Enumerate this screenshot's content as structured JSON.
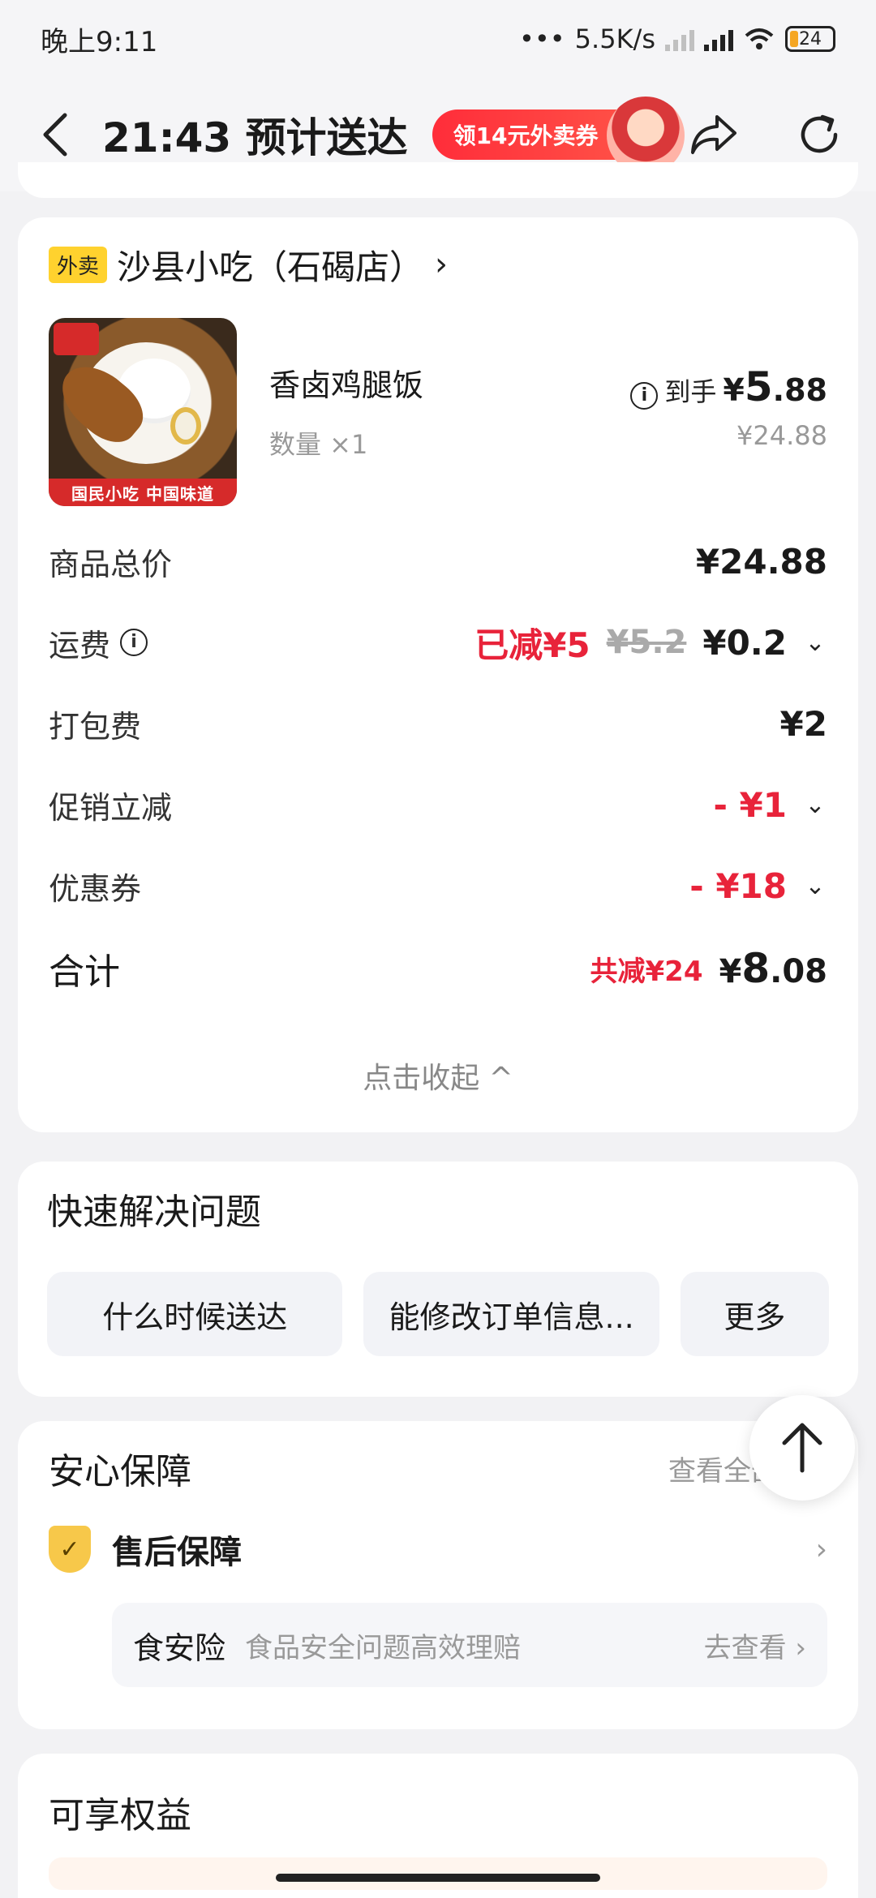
{
  "status_bar": {
    "time": "晚上9:11",
    "network_speed": "5.5K/s",
    "battery": "24"
  },
  "nav": {
    "title": "21:43 预计送达",
    "coupon_label": "领14元外卖券"
  },
  "order": {
    "tag": "外卖",
    "shop_name": "沙县小吃（石碣店）",
    "item": {
      "name": "香卤鸡腿饭",
      "quantity": "数量 ×1",
      "hand_label": "到手",
      "hand_price_symbol": "¥",
      "hand_price_int": "5",
      "hand_price_dec": ".88",
      "original_price": "¥24.88",
      "image_strip_text": "国民小吃 中国味道"
    },
    "fees": {
      "goods_total_label": "商品总价",
      "goods_total_value": "¥24.88",
      "delivery_label": "运费",
      "delivery_reduced": "已减¥5",
      "delivery_original": "¥5.2",
      "delivery_value": "¥0.2",
      "packing_label": "打包费",
      "packing_value": "¥2",
      "promo_label": "促销立减",
      "promo_value": "- ¥1",
      "coupon_label": "优惠券",
      "coupon_value": "- ¥18",
      "total_label": "合计",
      "total_saved": "共减¥24",
      "total_symbol": "¥",
      "total_int": "8",
      "total_dec": ".08"
    },
    "collapse_label": "点击收起 ^"
  },
  "quick_solve": {
    "title": "快速解决问题",
    "buttons": [
      "什么时候送达",
      "能修改订单信息...",
      "更多"
    ]
  },
  "guarantee": {
    "title": "安心保障",
    "view_all": "查看全部",
    "after_sale": "售后保障",
    "insurance_name": "食安险",
    "insurance_desc": "食品安全问题高效理赔",
    "insurance_go": "去查看"
  },
  "benefits": {
    "title": "可享权益"
  },
  "colors": {
    "accent_red": "#e8233a",
    "tag_yellow": "#ffd22e",
    "page_bg": "#f2f2f4"
  }
}
